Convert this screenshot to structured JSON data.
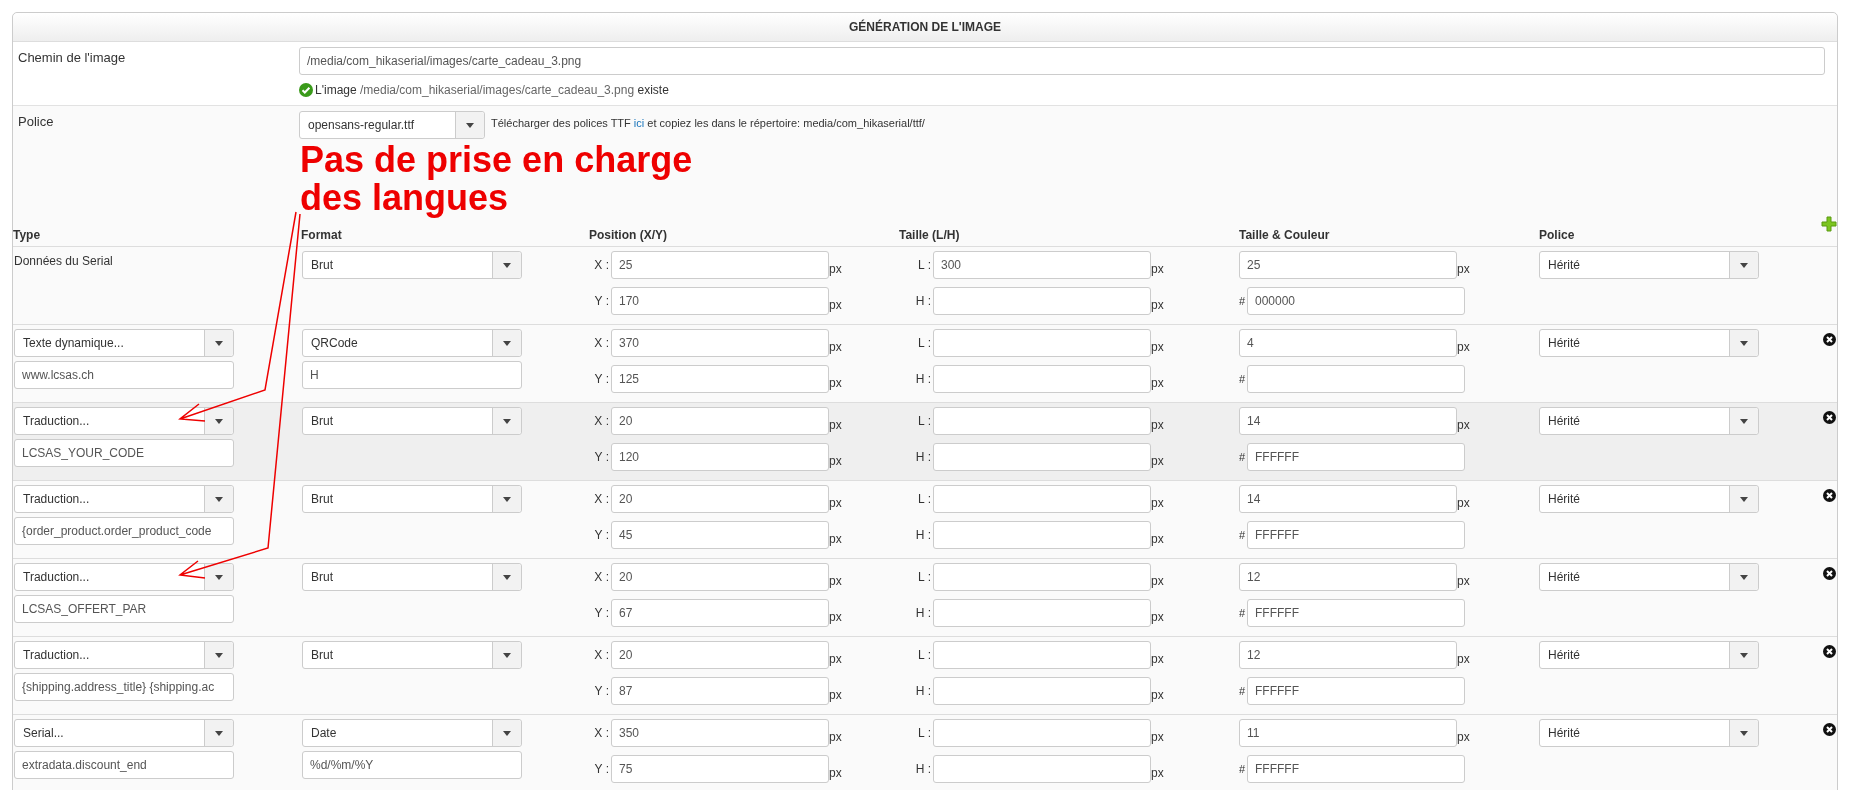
{
  "panel": {
    "title": "GÉNÉRATION DE L'IMAGE"
  },
  "image_path": {
    "label": "Chemin de l'image",
    "value": "/media/com_hikaserial/images/carte_cadeau_3.png",
    "exists": true,
    "status_before": "L'image",
    "status_path": "/media/com_hikaserial/images/carte_cadeau_3.png",
    "status_after": "existe"
  },
  "font": {
    "label": "Police",
    "value": "opensans-regular.ttf",
    "hint_before": "Télécharger des polices TTF",
    "hint_link": "ici",
    "hint_after": "et copiez les dans le répertoire: media/com_hikaserial/ttf/"
  },
  "table": {
    "columns": [
      "Type",
      "Format",
      "Position (X/Y)",
      "Taille (L/H)",
      "Taille & Couleur",
      "Police"
    ],
    "add_button": true,
    "rows": [
      {
        "highlighted": false,
        "removable": false,
        "type": {
          "kind": "text",
          "label": "Données du Serial"
        },
        "format": {
          "value": "Brut"
        },
        "position": [
          {
            "label": "X :",
            "value": "25",
            "unit": "px"
          },
          {
            "label": "Y :",
            "value": "170",
            "unit": "px"
          }
        ],
        "size": [
          {
            "label": "L :",
            "value": "300",
            "unit": "px"
          },
          {
            "label": "H :",
            "unit": "px"
          }
        ],
        "font_size": {
          "value": "25",
          "unit": "px"
        },
        "color": {
          "label": "#",
          "value": "000000"
        },
        "police": "Hérité"
      },
      {
        "highlighted": false,
        "removable": true,
        "type": {
          "kind": "select",
          "value": "Texte dynamique...",
          "input": "www.lcsas.ch"
        },
        "format": {
          "value": "QRCode",
          "input": "H"
        },
        "position": [
          {
            "label": "X :",
            "value": "370",
            "unit": "px"
          },
          {
            "label": "Y :",
            "value": "125",
            "unit": "px"
          }
        ],
        "size": [
          {
            "label": "L :",
            "unit": "px"
          },
          {
            "label": "H :",
            "unit": "px"
          }
        ],
        "font_size": {
          "value": "4",
          "unit": "px"
        },
        "color": {
          "label": "#"
        },
        "police": "Hérité"
      },
      {
        "highlighted": true,
        "removable": true,
        "type": {
          "kind": "select",
          "value": "Traduction...",
          "input": "LCSAS_YOUR_CODE"
        },
        "format": {
          "value": "Brut"
        },
        "position": [
          {
            "label": "X :",
            "value": "20",
            "unit": "px"
          },
          {
            "label": "Y :",
            "value": "120",
            "unit": "px"
          }
        ],
        "size": [
          {
            "label": "L :",
            "unit": "px"
          },
          {
            "label": "H :",
            "unit": "px"
          }
        ],
        "font_size": {
          "value": "14",
          "unit": "px"
        },
        "color": {
          "label": "#",
          "value": "FFFFFF"
        },
        "police": "Hérité"
      },
      {
        "highlighted": false,
        "removable": true,
        "type": {
          "kind": "select",
          "value": "Traduction...",
          "input": "{order_product.order_product_code"
        },
        "format": {
          "value": "Brut"
        },
        "position": [
          {
            "label": "X :",
            "value": "20",
            "unit": "px"
          },
          {
            "label": "Y :",
            "value": "45",
            "unit": "px"
          }
        ],
        "size": [
          {
            "label": "L :",
            "unit": "px"
          },
          {
            "label": "H :",
            "unit": "px"
          }
        ],
        "font_size": {
          "value": "14",
          "unit": "px"
        },
        "color": {
          "label": "#",
          "value": "FFFFFF"
        },
        "police": "Hérité"
      },
      {
        "highlighted": false,
        "removable": true,
        "type": {
          "kind": "select",
          "value": "Traduction...",
          "input": "LCSAS_OFFERT_PAR"
        },
        "format": {
          "value": "Brut"
        },
        "position": [
          {
            "label": "X :",
            "value": "20",
            "unit": "px"
          },
          {
            "label": "Y :",
            "value": "67",
            "unit": "px"
          }
        ],
        "size": [
          {
            "label": "L :",
            "unit": "px"
          },
          {
            "label": "H :",
            "unit": "px"
          }
        ],
        "font_size": {
          "value": "12",
          "unit": "px"
        },
        "color": {
          "label": "#",
          "value": "FFFFFF"
        },
        "police": "Hérité"
      },
      {
        "highlighted": false,
        "removable": true,
        "type": {
          "kind": "select",
          "value": "Traduction...",
          "input": "{shipping.address_title} {shipping.ac"
        },
        "format": {
          "value": "Brut"
        },
        "position": [
          {
            "label": "X :",
            "value": "20",
            "unit": "px"
          },
          {
            "label": "Y :",
            "value": "87",
            "unit": "px"
          }
        ],
        "size": [
          {
            "label": "L :",
            "unit": "px"
          },
          {
            "label": "H :",
            "unit": "px"
          }
        ],
        "font_size": {
          "value": "12",
          "unit": "px"
        },
        "color": {
          "label": "#",
          "value": "FFFFFF"
        },
        "police": "Hérité"
      },
      {
        "highlighted": false,
        "removable": true,
        "type": {
          "kind": "select",
          "value": "Serial...",
          "input": "extradata.discount_end"
        },
        "format": {
          "value": "Date",
          "input": "%d/%m/%Y"
        },
        "position": [
          {
            "label": "X :",
            "value": "350",
            "unit": "px"
          },
          {
            "label": "Y :",
            "value": "75",
            "unit": "px"
          }
        ],
        "size": [
          {
            "label": "L :",
            "unit": "px"
          },
          {
            "label": "H :",
            "unit": "px"
          }
        ],
        "font_size": {
          "value": "11",
          "unit": "px"
        },
        "color": {
          "label": "#",
          "value": "FFFFFF"
        },
        "police": "Hérité"
      }
    ]
  },
  "annotation": {
    "lines": [
      "Pas de prise en charge",
      "des langues"
    ]
  }
}
